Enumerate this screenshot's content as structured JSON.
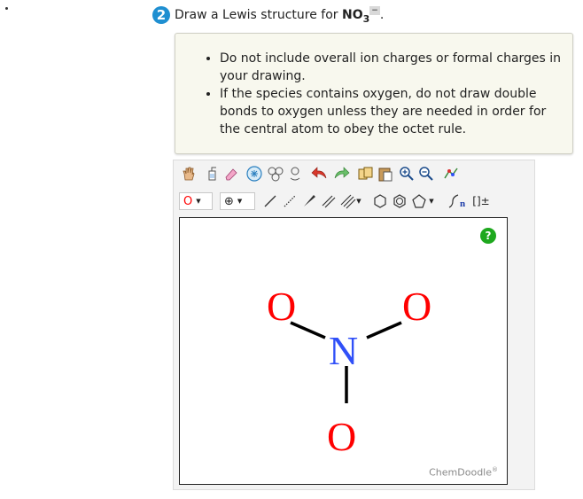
{
  "question": {
    "number": "2",
    "prompt": "Draw a Lewis structure for ",
    "formula": "NO",
    "subscript": "3",
    "charge": "−",
    "end": "."
  },
  "instructions": [
    "Do not include overall ion charges or formal charges in your drawing.",
    "If the species contains oxygen, do not draw double bonds to oxygen unless they are needed in order for the central atom to obey the octet rule."
  ],
  "toolbar": {
    "element_select_value": "O",
    "charge_select_value": "⊕",
    "bond_order_label": "n",
    "bracket_label": "[]±"
  },
  "molecule": {
    "atoms": [
      {
        "symbol": "O",
        "color": "#ff0000"
      },
      {
        "symbol": "O",
        "color": "#ff0000"
      },
      {
        "symbol": "N",
        "color": "#3050f8"
      },
      {
        "symbol": "O",
        "color": "#ff0000"
      }
    ]
  },
  "canvas": {
    "help_label": "?",
    "brand": "ChemDoodle",
    "brand_mark": "®"
  },
  "colors": {
    "question_badge": "#1f8fd1",
    "help_button": "#1ea81e",
    "oxygen": "#ff0000",
    "nitrogen": "#3050f8"
  }
}
